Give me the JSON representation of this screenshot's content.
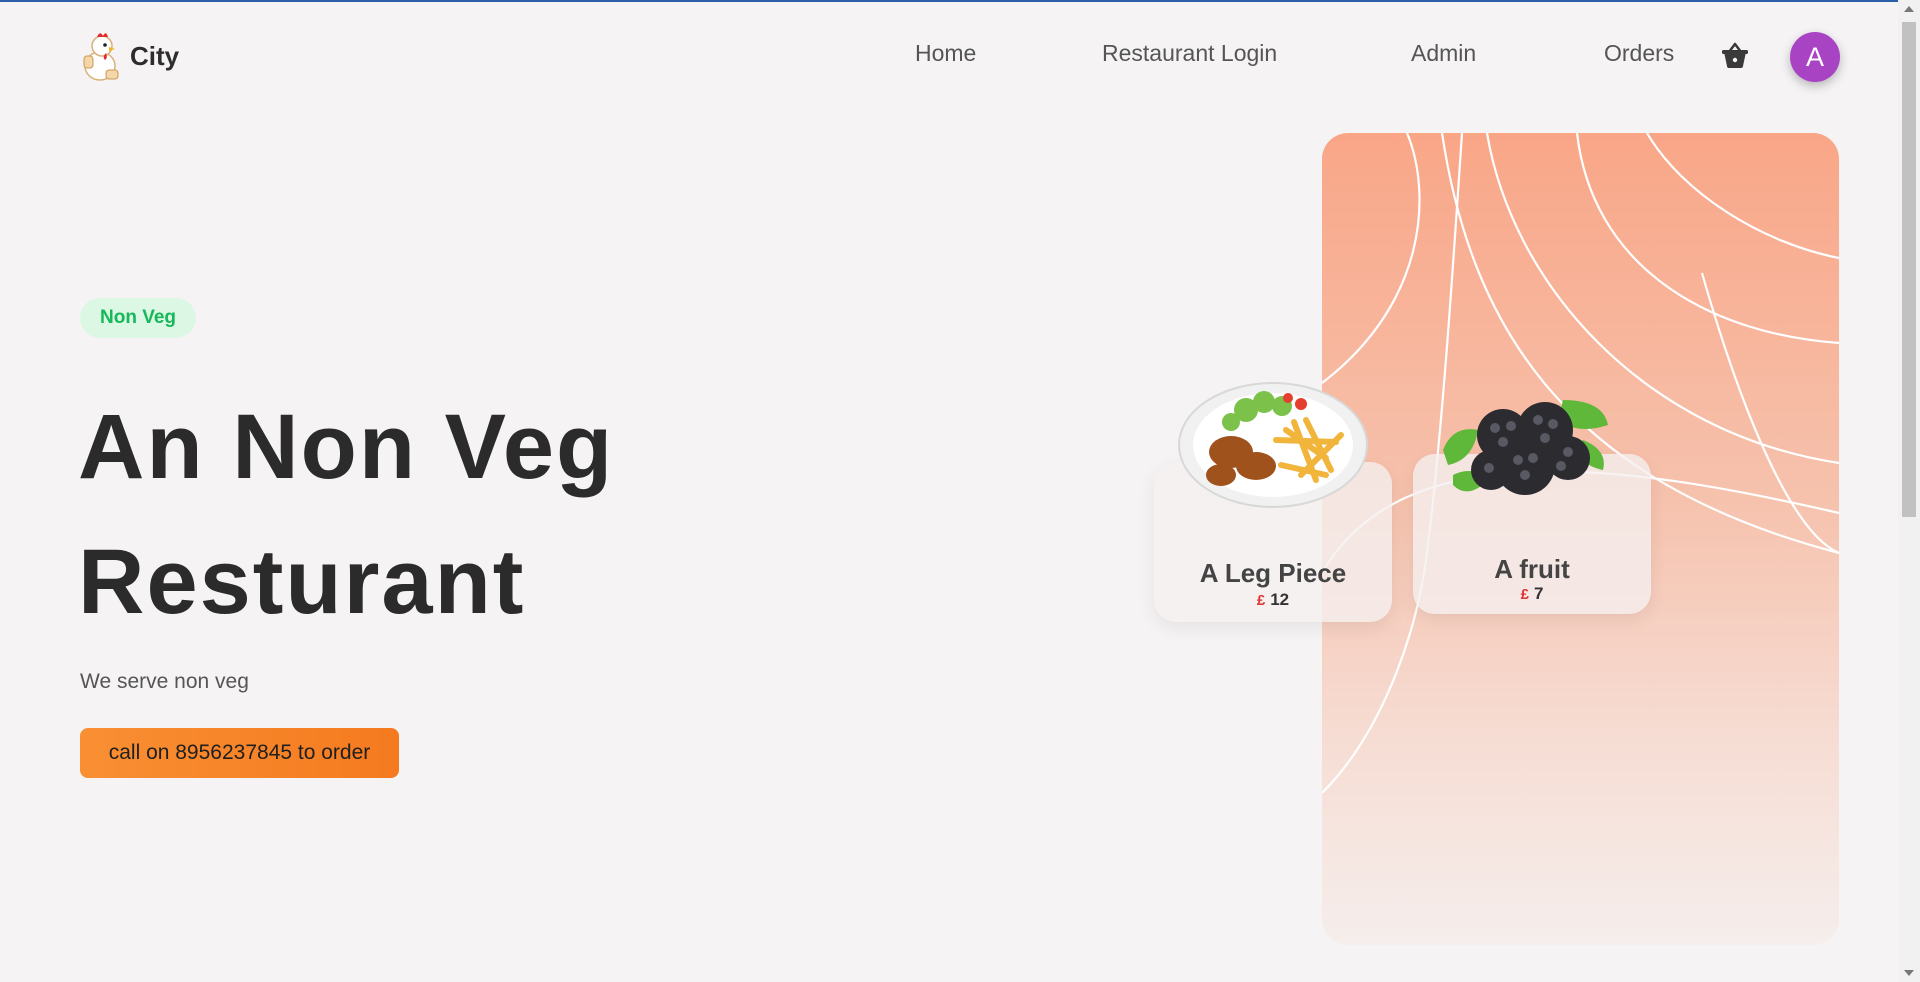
{
  "brand": {
    "name": "City",
    "logo_icon": "chicken-chef-icon"
  },
  "nav": {
    "items": [
      {
        "label": "Home"
      },
      {
        "label": "Restaurant Login"
      },
      {
        "label": "Admin"
      },
      {
        "label": "Orders"
      }
    ],
    "cart_icon": "basket-icon",
    "avatar_letter": "A",
    "avatar_color": "#a843c4"
  },
  "hero": {
    "badge": "Non Veg",
    "headline_line1": "An Non Veg",
    "headline_line2": "Resturant",
    "subtitle": "We serve non veg",
    "cta_label": "call on 8956237845 to order"
  },
  "cards": [
    {
      "title": "A Leg Piece",
      "currency": "£",
      "price": "12",
      "image": "chicken-fries-plate"
    },
    {
      "title": "A fruit",
      "currency": "£",
      "price": "7",
      "image": "blackberries"
    }
  ],
  "colors": {
    "accent_orange": "#f57a1f",
    "badge_green": "#17b85a",
    "panel_peach": "#f9a687",
    "price_currency": "#e03131"
  }
}
